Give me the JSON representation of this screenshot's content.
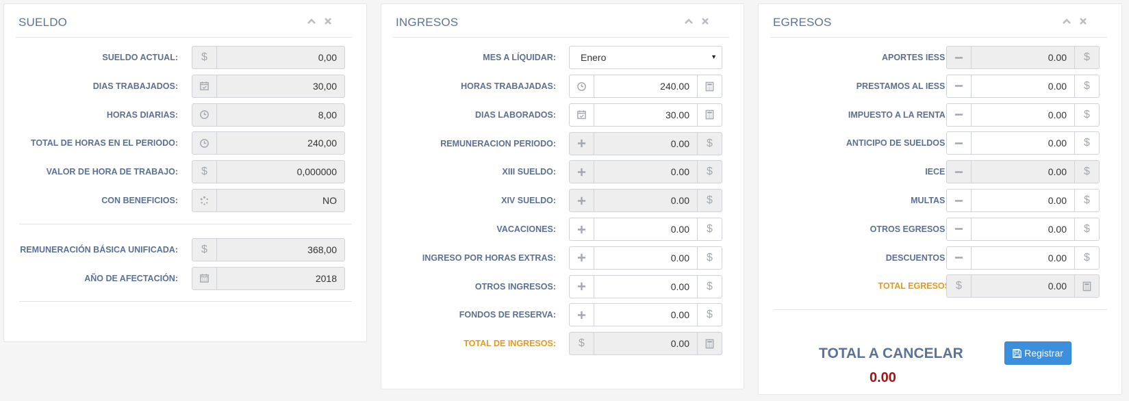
{
  "sueldo": {
    "title": "SUELDO",
    "rows": [
      {
        "label": "SUELDO ACTUAL:",
        "value": "0,00",
        "icon": "dollar-icon"
      },
      {
        "label": "DIAS TRABAJADOS:",
        "value": "30,00",
        "icon": "calendar-check-icon"
      },
      {
        "label": "HORAS DIARIAS:",
        "value": "8,00",
        "icon": "clock-icon"
      },
      {
        "label": "TOTAL DE HORAS EN EL PERIODO:",
        "value": "240,00",
        "icon": "clock-icon"
      },
      {
        "label": "VALOR DE HORA DE TRABAJO:",
        "value": "0,000000",
        "icon": "dollar-icon"
      },
      {
        "label": "CON BENEFICIOS:",
        "value": "NO",
        "icon": "spinner-icon"
      }
    ],
    "rows2": [
      {
        "label": "REMUNERACIÓN BÁSICA UNIFICADA:",
        "value": "368,00",
        "icon": "dollar-icon"
      },
      {
        "label": "AÑO DE AFECTACIÓN:",
        "value": "2018",
        "icon": "calendar-icon"
      }
    ]
  },
  "ingresos": {
    "title": "INGRESOS",
    "mes_label": "MES A LÍQUIDAR:",
    "mes_value": "Enero",
    "rows": [
      {
        "label": "HORAS TRABAJADAS:",
        "value": "240.00",
        "left": "clock-icon",
        "right": "calculator-icon",
        "readonly": false
      },
      {
        "label": "DIAS LABORADOS:",
        "value": "30.00",
        "left": "calendar-check-icon",
        "right": "calculator-icon",
        "readonly": false
      },
      {
        "label": "REMUNERACION PERIODO:",
        "value": "0.00",
        "left": "plus-icon",
        "right": "dollar-icon",
        "readonly": true
      },
      {
        "label": "XIII SUELDO:",
        "value": "0.00",
        "left": "plus-icon",
        "right": "dollar-icon",
        "readonly": true
      },
      {
        "label": "XIV SUELDO:",
        "value": "0.00",
        "left": "plus-icon",
        "right": "dollar-icon",
        "readonly": true
      },
      {
        "label": "VACACIONES:",
        "value": "0.00",
        "left": "plus-icon",
        "right": "dollar-icon",
        "readonly": false
      },
      {
        "label": "INGRESO POR HORAS EXTRAS:",
        "value": "0.00",
        "left": "plus-icon",
        "right": "dollar-icon",
        "readonly": false
      },
      {
        "label": "OTROS INGRESOS:",
        "value": "0.00",
        "left": "plus-icon",
        "right": "dollar-icon",
        "readonly": false
      },
      {
        "label": "FONDOS DE RESERVA:",
        "value": "0.00",
        "left": "plus-icon",
        "right": "dollar-icon",
        "readonly": false
      },
      {
        "label": "TOTAL DE INGRESOS:",
        "value": "0.00",
        "left": "dollar-icon",
        "right": "calculator-icon",
        "readonly": true,
        "total": true
      }
    ]
  },
  "egresos": {
    "title": "EGRESOS",
    "rows": [
      {
        "label": "APORTES IESS :",
        "value": "0.00",
        "left": "minus-icon",
        "right": "dollar-icon",
        "readonly": true
      },
      {
        "label": "PRESTAMOS AL IESS :",
        "value": "0.00",
        "left": "minus-icon",
        "right": "dollar-icon",
        "readonly": false
      },
      {
        "label": "IMPUESTO A LA RENTA :",
        "value": "0.00",
        "left": "minus-icon",
        "right": "dollar-icon",
        "readonly": false
      },
      {
        "label": "ANTICIPO DE SUELDOS :",
        "value": "0.00",
        "left": "minus-icon",
        "right": "dollar-icon",
        "readonly": false
      },
      {
        "label": "IECE :",
        "value": "0.00",
        "left": "minus-icon",
        "right": "dollar-icon",
        "readonly": true
      },
      {
        "label": "MULTAS :",
        "value": "0.00",
        "left": "minus-icon",
        "right": "dollar-icon",
        "readonly": false
      },
      {
        "label": "OTROS EGRESOS :",
        "value": "0.00",
        "left": "minus-icon",
        "right": "dollar-icon",
        "readonly": false
      },
      {
        "label": "DESCUENTOS :",
        "value": "0.00",
        "left": "minus-icon",
        "right": "dollar-icon",
        "readonly": false
      },
      {
        "label": "TOTAL EGRESOS",
        "value": "0.00",
        "left": "dollar-icon",
        "right": "calculator-icon",
        "readonly": true,
        "total": true
      }
    ],
    "total_cancelar_label": "TOTAL A CANCELAR",
    "total_cancelar_value": "0.00",
    "registrar_label": "Registrar"
  },
  "colors": {
    "label": "#5b7093",
    "title": "#5c7399",
    "total_label": "#e69a1b",
    "total_value": "#a01414",
    "button": "#3b8fdd"
  }
}
